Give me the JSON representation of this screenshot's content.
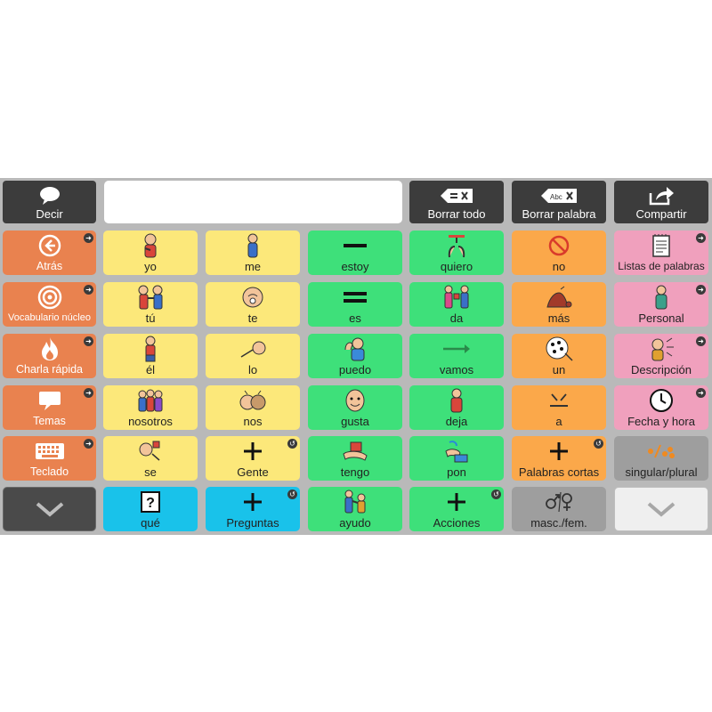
{
  "toolbar": {
    "speak_label": "Decir",
    "clear_all_label": "Borrar todo",
    "clear_word_label": "Borrar palabra",
    "share_label": "Compartir"
  },
  "sidebar": {
    "items": [
      {
        "label": "Atrás"
      },
      {
        "label": "Vocabulario núcleo"
      },
      {
        "label": "Charla rápida"
      },
      {
        "label": "Temas"
      },
      {
        "label": "Teclado"
      }
    ]
  },
  "grid": {
    "rows": [
      [
        "yo",
        "me",
        "estoy",
        "quiero",
        "no",
        "Listas de palabras"
      ],
      [
        "tú",
        "te",
        "es",
        "da",
        "más",
        "Personal"
      ],
      [
        "él",
        "lo",
        "puedo",
        "vamos",
        "un",
        "Descripción"
      ],
      [
        "nosotros",
        "nos",
        "gusta",
        "deja",
        "a",
        "Fecha y hora"
      ],
      [
        "se",
        "Gente",
        "tengo",
        "pon",
        "Palabras cortas",
        "singular/plural"
      ],
      [
        "qué",
        "Preguntas",
        "ayudo",
        "Acciones",
        "masc./fem."
      ]
    ]
  },
  "colors": {
    "yellow": "#fce87a",
    "green": "#3ee07a",
    "orange": "#fba84a",
    "pink": "#f0a0bd",
    "blue": "#19c2ea",
    "gray": "#9e9e9e",
    "side": "#e9824f",
    "dark": "#3c3c3c"
  }
}
